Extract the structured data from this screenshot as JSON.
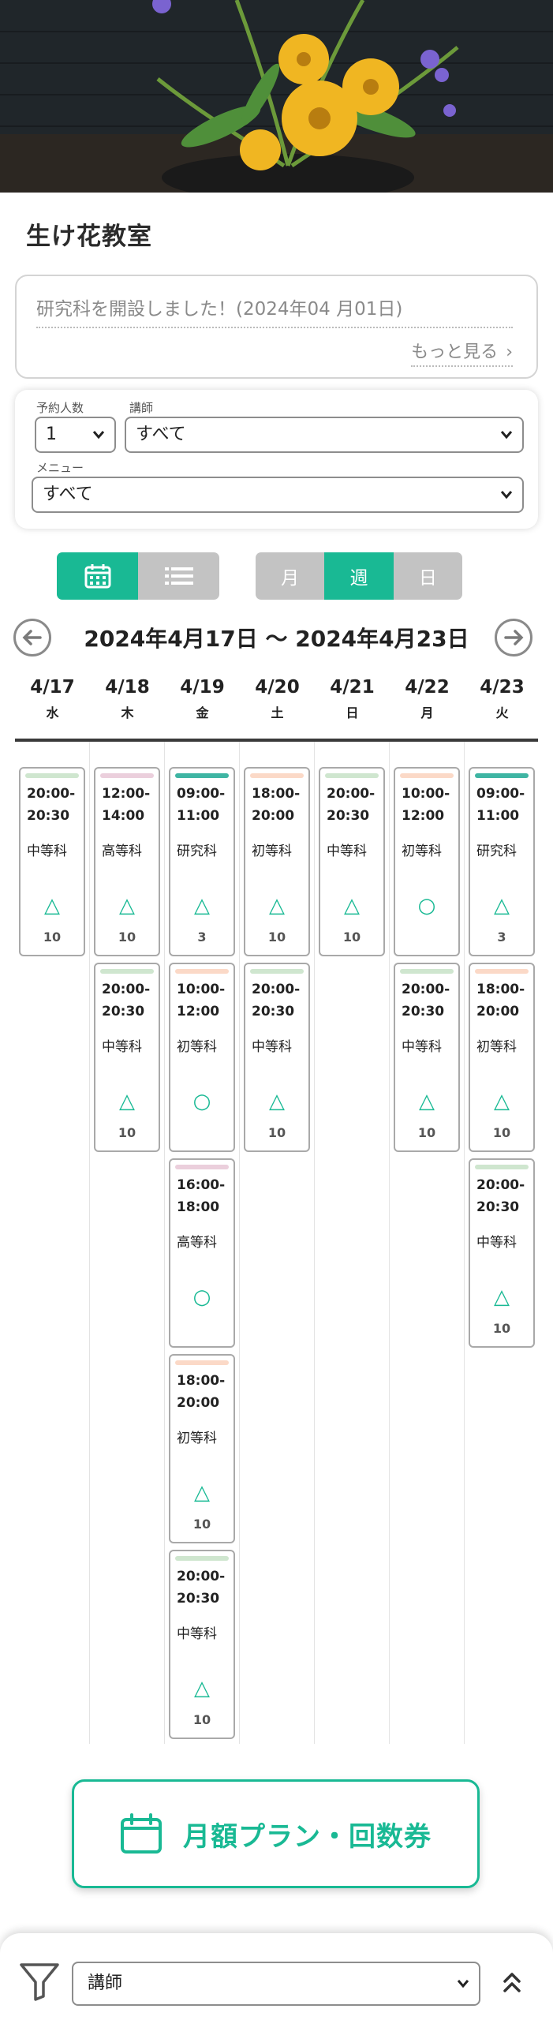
{
  "page": {
    "title": "生け花教室"
  },
  "news": {
    "text": "研究科を開設しました！(2024年04 月01日)",
    "more_label": "もっと見る"
  },
  "filters": {
    "people_label": "予約人数",
    "people_value": "1",
    "instructor_label": "講師",
    "instructor_value": "すべて",
    "menu_label": "メニュー",
    "menu_value": "すべて"
  },
  "view_toggle": {
    "selected": "calendar"
  },
  "period_toggle": {
    "month": "月",
    "week": "週",
    "day": "日",
    "selected": "週"
  },
  "range": {
    "label": "2024年4月17日 〜 2024年4月23日"
  },
  "colors": {
    "accent": "#19b994",
    "bar_green": "#cfe6cf",
    "bar_pink": "#ebcfdc",
    "bar_peach": "#fbd9c7",
    "bar_teal": "#3fb5a3"
  },
  "days": [
    {
      "date": "4/17",
      "weekday": "水",
      "slots": [
        {
          "time1": "20:00-",
          "time2": "20:30",
          "class": "中等科",
          "status": "△",
          "count": "10",
          "bar": "green"
        }
      ]
    },
    {
      "date": "4/18",
      "weekday": "木",
      "slots": [
        {
          "time1": "12:00-",
          "time2": "14:00",
          "class": "高等科",
          "status": "△",
          "count": "10",
          "bar": "pink"
        },
        {
          "time1": "20:00-",
          "time2": "20:30",
          "class": "中等科",
          "status": "△",
          "count": "10",
          "bar": "green"
        }
      ]
    },
    {
      "date": "4/19",
      "weekday": "金",
      "slots": [
        {
          "time1": "09:00-",
          "time2": "11:00",
          "class": "研究科",
          "status": "△",
          "count": "3",
          "bar": "teal"
        },
        {
          "time1": "10:00-",
          "time2": "12:00",
          "class": "初等科",
          "status": "○",
          "count": "",
          "bar": "peach"
        },
        {
          "time1": "16:00-",
          "time2": "18:00",
          "class": "高等科",
          "status": "○",
          "count": "",
          "bar": "pink"
        },
        {
          "time1": "18:00-",
          "time2": "20:00",
          "class": "初等科",
          "status": "△",
          "count": "10",
          "bar": "peach"
        },
        {
          "time1": "20:00-",
          "time2": "20:30",
          "class": "中等科",
          "status": "△",
          "count": "10",
          "bar": "green"
        }
      ]
    },
    {
      "date": "4/20",
      "weekday": "土",
      "slots": [
        {
          "time1": "18:00-",
          "time2": "20:00",
          "class": "初等科",
          "status": "△",
          "count": "10",
          "bar": "peach"
        },
        {
          "time1": "20:00-",
          "time2": "20:30",
          "class": "中等科",
          "status": "△",
          "count": "10",
          "bar": "green"
        }
      ]
    },
    {
      "date": "4/21",
      "weekday": "日",
      "slots": [
        {
          "time1": "20:00-",
          "time2": "20:30",
          "class": "中等科",
          "status": "△",
          "count": "10",
          "bar": "green"
        }
      ]
    },
    {
      "date": "4/22",
      "weekday": "月",
      "slots": [
        {
          "time1": "10:00-",
          "time2": "12:00",
          "class": "初等科",
          "status": "○",
          "count": "",
          "bar": "peach"
        },
        {
          "time1": "20:00-",
          "time2": "20:30",
          "class": "中等科",
          "status": "△",
          "count": "10",
          "bar": "green"
        }
      ]
    },
    {
      "date": "4/23",
      "weekday": "火",
      "slots": [
        {
          "time1": "09:00-",
          "time2": "11:00",
          "class": "研究科",
          "status": "△",
          "count": "3",
          "bar": "teal"
        },
        {
          "time1": "18:00-",
          "time2": "20:00",
          "class": "初等科",
          "status": "△",
          "count": "10",
          "bar": "peach"
        },
        {
          "time1": "20:00-",
          "time2": "20:30",
          "class": "中等科",
          "status": "△",
          "count": "10",
          "bar": "green"
        }
      ]
    }
  ],
  "plan_button": {
    "label": "月額プラン・回数券"
  },
  "bottom_bar": {
    "filter_value": "講師"
  }
}
